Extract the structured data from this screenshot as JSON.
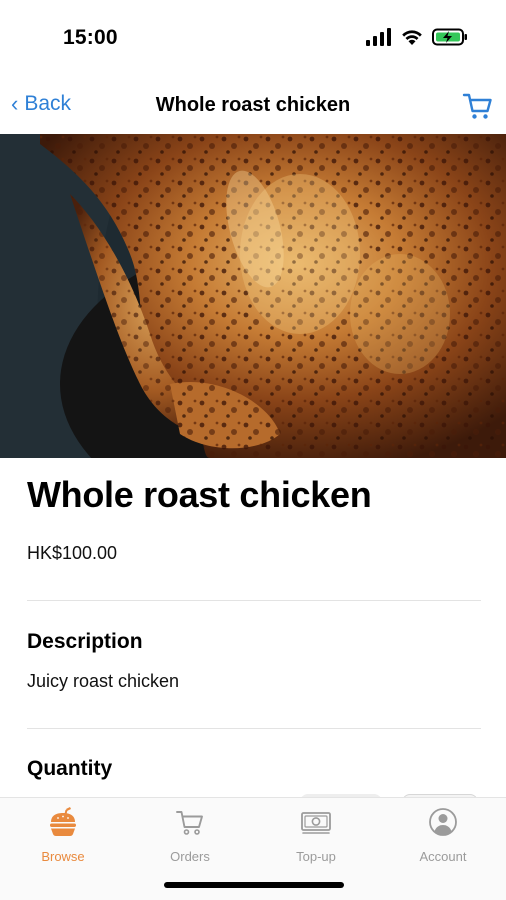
{
  "status_bar": {
    "time": "15:00",
    "icons": [
      "signal-icon",
      "wifi-icon",
      "battery-charging-icon"
    ],
    "battery_color": "#34c759"
  },
  "nav": {
    "back_label": "Back",
    "title": "Whole roast chicken",
    "accent": "#2f80d6"
  },
  "product": {
    "image": "roast-chicken-photo",
    "title": "Whole roast chicken",
    "price": "HK$100.00",
    "description_heading": "Description",
    "description": "Juicy roast chicken",
    "quantity_heading": "Quantity"
  },
  "tab_bar": {
    "active_color": "#e98a3e",
    "inactive_color": "#9b9b9b",
    "tabs": [
      {
        "label": "Browse",
        "icon": "burger-icon",
        "active": true
      },
      {
        "label": "Orders",
        "icon": "cart-icon",
        "active": false
      },
      {
        "label": "Top-up",
        "icon": "money-icon",
        "active": false
      },
      {
        "label": "Account",
        "icon": "user-circle-icon",
        "active": false
      }
    ]
  }
}
